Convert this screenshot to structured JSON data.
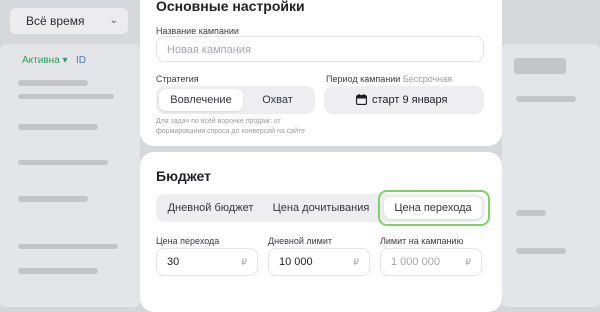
{
  "background": {
    "period_select": "Всё время",
    "status_filter": "Активна",
    "id_label": "ID"
  },
  "basic_settings": {
    "title": "Основные настройки",
    "campaign_name_label": "Название кампании",
    "campaign_name_placeholder": "Новая кампания",
    "campaign_name_value": "",
    "strategy_label": "Стратегия",
    "strategy_options": [
      "Вовлечение",
      "Охват"
    ],
    "strategy_selected": "Вовлечение",
    "strategy_hint": "Для задач по всей воронке продаж: от формирования спроса до конверсий на сайте",
    "period_label": "Период кампании",
    "period_note": "Бессрочная",
    "period_button": "старт 9 января"
  },
  "budget": {
    "title": "Бюджет",
    "tabs": [
      "Дневной бюджет",
      "Цена дочитывания",
      "Цена перехода"
    ],
    "selected_tab": "Цена перехода",
    "fields": [
      {
        "label": "Цена перехода",
        "value": "30",
        "currency": "₽",
        "placeholder": false
      },
      {
        "label": "Дневной лимит",
        "value": "10 000",
        "currency": "₽",
        "placeholder": false
      },
      {
        "label": "Лимит на кампанию",
        "value": "1 000 000",
        "currency": "₽",
        "placeholder": true
      }
    ]
  },
  "colors": {
    "highlight": "#7bd26a",
    "active_status": "#2e9e5a",
    "link": "#3b7bd6"
  },
  "icons": {
    "calendar": "calendar-icon",
    "chevron": "chevron-down-icon"
  }
}
